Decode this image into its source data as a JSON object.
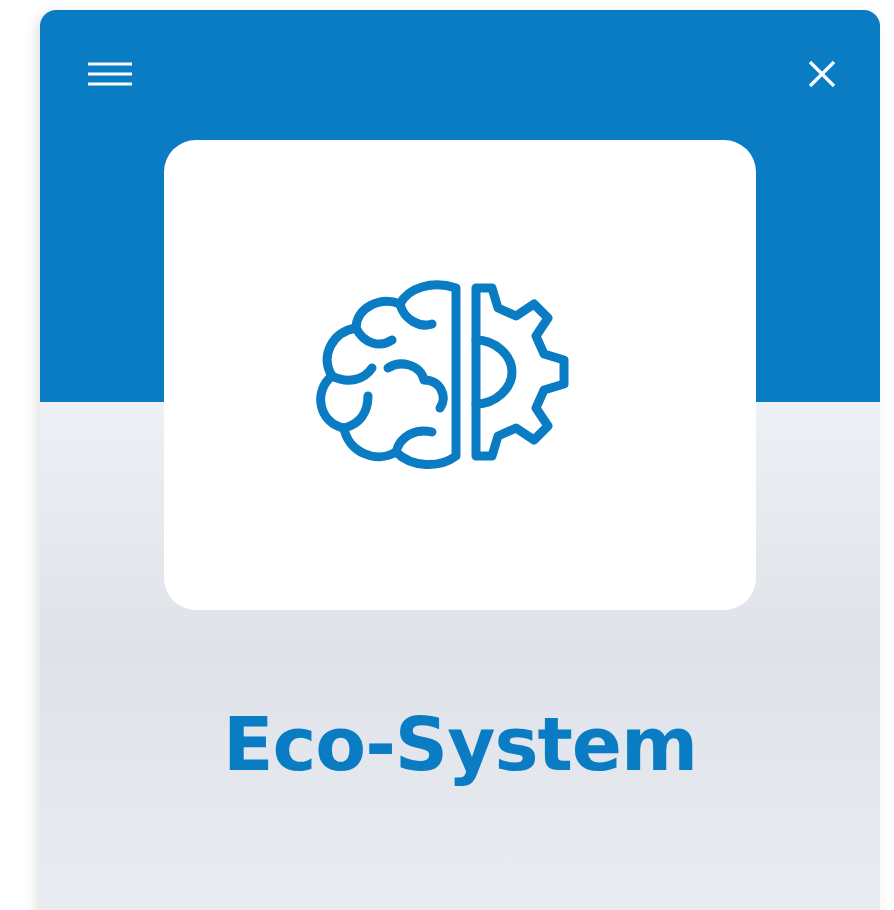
{
  "title": "Eco-System"
}
